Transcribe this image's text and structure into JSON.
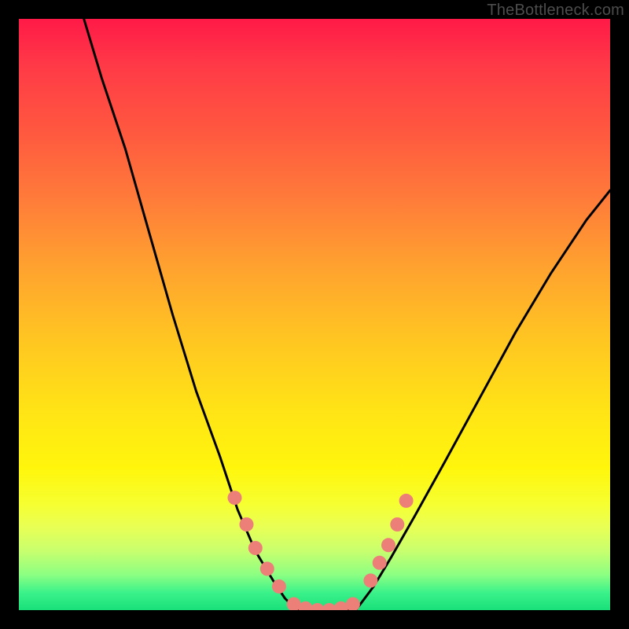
{
  "watermark": "TheBottleneck.com",
  "colors": {
    "curve": "#000000",
    "bead": "#ec8079",
    "background_top": "#ff1a47",
    "background_bottom": "#19e07a",
    "frame": "#000000"
  },
  "chart_data": {
    "type": "line",
    "title": "",
    "xlabel": "",
    "ylabel": "",
    "xlim": [
      0,
      100
    ],
    "ylim": [
      0,
      100
    ],
    "note": "y is a qualitative 'bottleneck' value: 0 = ideal (green, bottom), 100 = worst (red, top). x is a normalized parameter. No numeric axis ticks are visible in the source image; values are approximate readings off the shape.",
    "series": [
      {
        "name": "left-curve",
        "x": [
          11,
          14,
          18,
          22,
          26,
          30,
          34,
          37,
          40,
          43,
          45,
          47
        ],
        "y": [
          100,
          90,
          78,
          64,
          50,
          37,
          26,
          17,
          10,
          5,
          2,
          0
        ]
      },
      {
        "name": "valley-floor",
        "x": [
          47,
          49,
          51,
          53,
          55,
          57
        ],
        "y": [
          0,
          0,
          0,
          0,
          0,
          0
        ]
      },
      {
        "name": "right-curve",
        "x": [
          57,
          60,
          63,
          67,
          72,
          78,
          84,
          90,
          96,
          100
        ],
        "y": [
          0,
          4,
          9,
          16,
          25,
          36,
          47,
          57,
          66,
          71
        ]
      }
    ],
    "beads": {
      "name": "highlighted-points",
      "note": "Salmon-colored circular markers overlaid on the curve near the valley.",
      "x": [
        36.5,
        38.5,
        40.0,
        42.0,
        44.0,
        46.5,
        48.5,
        50.5,
        52.5,
        54.5,
        56.5,
        59.5,
        61.0,
        62.5,
        64.0,
        65.5
      ],
      "y": [
        19.0,
        14.5,
        10.5,
        7.0,
        4.0,
        1.0,
        0.3,
        0.0,
        0.0,
        0.3,
        1.0,
        5.0,
        8.0,
        11.0,
        14.5,
        18.5
      ]
    }
  }
}
